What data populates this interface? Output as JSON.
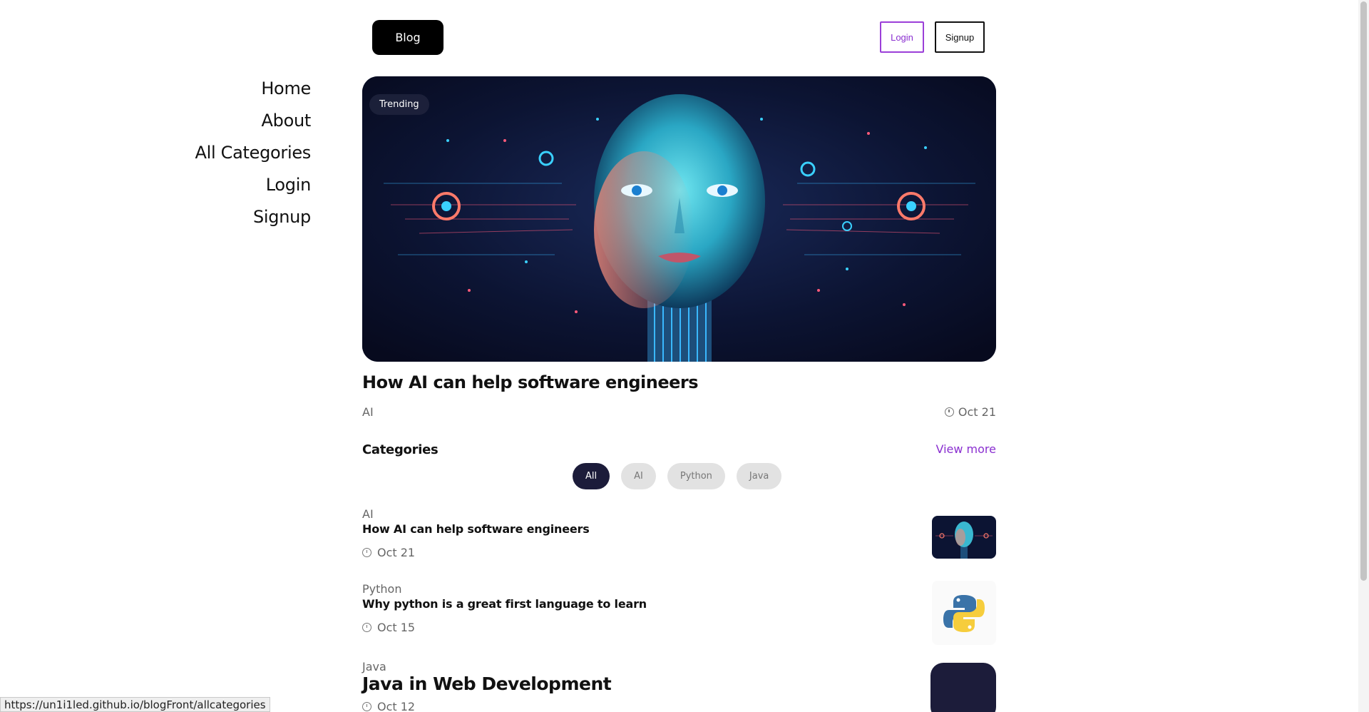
{
  "sidebar": {
    "items": [
      {
        "label": "Home"
      },
      {
        "label": "About"
      },
      {
        "label": "All Categories"
      },
      {
        "label": "Login"
      },
      {
        "label": "Signup"
      }
    ]
  },
  "header": {
    "blog_label": "Blog",
    "login_label": "Login",
    "signup_label": "Signup"
  },
  "hero": {
    "badge": "Trending",
    "title": "How AI can help software engineers",
    "category": "AI",
    "date": "Oct 21"
  },
  "categories": {
    "heading": "Categories",
    "view_more": "View more",
    "chips": [
      {
        "label": "All",
        "active": true
      },
      {
        "label": "AI",
        "active": false
      },
      {
        "label": "Python",
        "active": false
      },
      {
        "label": "Java",
        "active": false
      }
    ]
  },
  "posts": [
    {
      "category": "AI",
      "title": "How AI can help software engineers",
      "date": "Oct 21",
      "thumb": "ai-face-image"
    },
    {
      "category": "Python",
      "title": "Why python is a great first language to learn",
      "date": "Oct 15",
      "thumb": "python-logo"
    },
    {
      "category": "Java",
      "title": "Java in Web Development",
      "date": "Oct 12",
      "thumb": "java-image"
    }
  ],
  "status_bar": {
    "url": "https://un1i1led.github.io/blogFront/allcategories"
  },
  "colors": {
    "accent": "#8a2fd0",
    "dark": "#1c1c3a"
  }
}
